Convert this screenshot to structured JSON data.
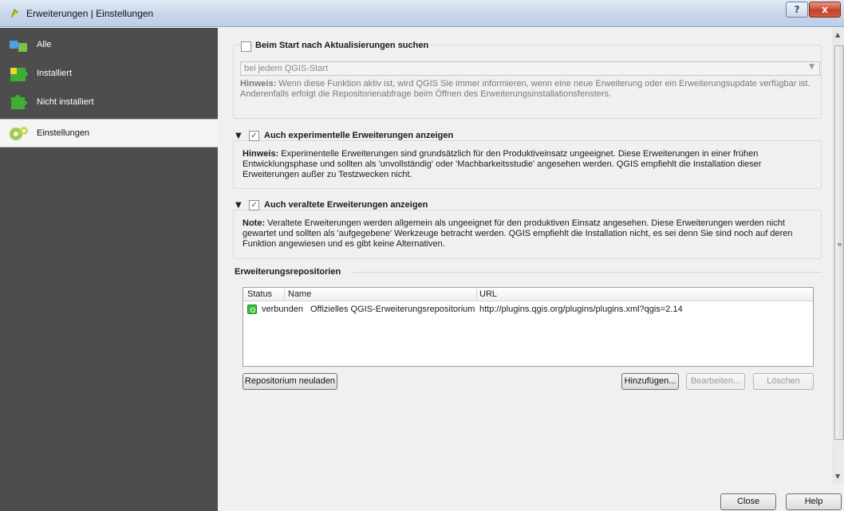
{
  "window": {
    "title": "Erweiterungen | Einstellungen",
    "help_label": "?",
    "close_label": "x"
  },
  "sidebar": {
    "items": [
      {
        "label": "Alle",
        "icon": "puzzle-pieces-icon"
      },
      {
        "label": "Installiert",
        "icon": "puzzle-installed-icon"
      },
      {
        "label": "Nicht installiert",
        "icon": "puzzle-not-installed-icon"
      },
      {
        "label": "Einstellungen",
        "icon": "gears-icon"
      }
    ]
  },
  "updates": {
    "checkbox_label": "Beim Start nach Aktualisierungen suchen",
    "checked": false,
    "frequency_value": "bei jedem QGIS-Start",
    "hint_prefix": "Hinweis:",
    "hint_text": "Wenn diese Funktion aktiv ist, wird QGIS Sie immer informieren, wenn eine neue Erweiterung oder ein Erweiterungsupdate verfügbar ist. Anderenfalls erfolgt die Repositorienabfrage beim Öffnen des Erweiterungsinstallationsfensters."
  },
  "experimental": {
    "checkbox_label": "Auch experimentelle Erweiterungen anzeigen",
    "checked": true,
    "hint_prefix": "Hinweis:",
    "hint_text": "Experimentelle Erweiterungen sind grundsätzlich für den Produktiveinsatz ungeeignet. Diese Erweiterungen in einer frühen Entwicklungsphase und sollten als 'unvollständig' oder 'Machbarkeitsstudie' angesehen werden. QGIS empfiehlt die Installation dieser Erweiterungen außer zu Testzwecken nicht."
  },
  "deprecated": {
    "checkbox_label": "Auch veraltete Erweiterungen anzeigen",
    "checked": true,
    "note_prefix": "Note:",
    "note_text": "Veraltete Erweiterungen werden allgemein als ungeeignet für den produktiven Einsatz angesehen. Diese Erweiterungen werden nicht gewartet und sollten als 'aufgegebene' Werkzeuge betracht werden. QGIS empfiehlt die Installation nicht, es sei denn Sie sind noch auf deren Funktion angewiesen und es gibt keine Alternativen."
  },
  "repositories": {
    "title": "Erweiterungsrepositorien",
    "columns": [
      "Status",
      "Name",
      "URL"
    ],
    "rows": [
      {
        "status": "verbunden",
        "name": "Offizielles QGIS-Erweiterungsrepositorium",
        "url": "http://plugins.qgis.org/plugins/plugins.xml?qgis=2.14"
      }
    ],
    "reload_label": "Repositorium neuladen",
    "add_label": "Hinzufügen...",
    "edit_label": "Bearbeiten...",
    "delete_label": "Löschen"
  },
  "footer": {
    "close_label": "Close",
    "help_label": "Help"
  },
  "arrows": {
    "expanded": "▼"
  },
  "check_mark": "✓"
}
